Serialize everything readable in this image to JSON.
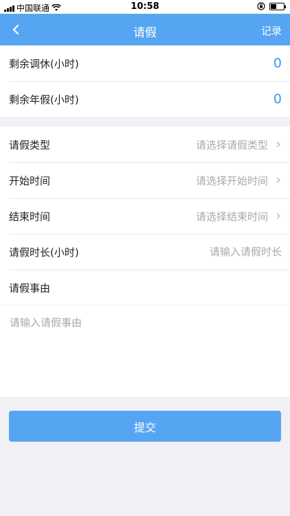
{
  "status_bar": {
    "carrier": "中国联通",
    "time": "10:58"
  },
  "header": {
    "title": "请假",
    "record_label": "记录"
  },
  "balance": {
    "items": [
      {
        "label": "剩余调休(小时)",
        "value": "0"
      },
      {
        "label": "剩余年假(小时)",
        "value": "0"
      }
    ]
  },
  "form": {
    "leave_type": {
      "label": "请假类型",
      "placeholder": "请选择请假类型"
    },
    "start_time": {
      "label": "开始时间",
      "placeholder": "请选择开始时间"
    },
    "end_time": {
      "label": "结束时间",
      "placeholder": "请选择结束时间"
    },
    "duration": {
      "label": "请假时长(小时)",
      "placeholder": "请输入请假时长"
    },
    "reason": {
      "label": "请假事由",
      "placeholder": "请输入请假事由"
    }
  },
  "submit_label": "提交",
  "colors": {
    "accent": "#56a5f3",
    "value_blue": "#3d97f2",
    "background": "#f0f0f5"
  }
}
